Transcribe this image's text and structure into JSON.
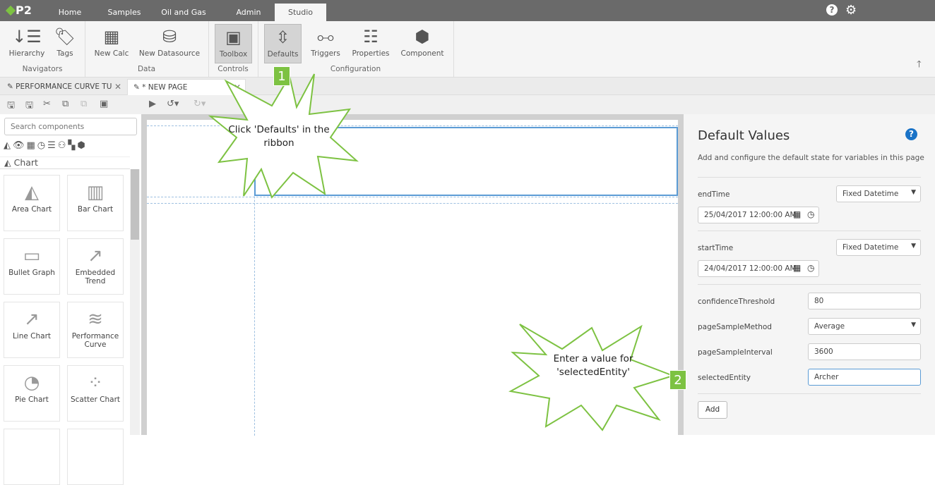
{
  "nav": {
    "logo": "P2",
    "tabs": [
      "Home",
      "Samples",
      "Oil and Gas",
      "Admin",
      "Studio"
    ],
    "active": "Studio",
    "help_icon": "?",
    "settings_icon": "gear"
  },
  "ribbon": {
    "buttons": [
      "Hierarchy",
      "Tags",
      "New Calc",
      "New Datasource",
      "Toolbox",
      "Defaults",
      "Triggers",
      "Properties",
      "Component"
    ],
    "groups": [
      "Navigators",
      "Data",
      "Controls",
      "Configuration"
    ]
  },
  "doc_tabs": [
    {
      "label": "PERFORMANCE CURVE TU"
    },
    {
      "label": "* NEW PAGE"
    }
  ],
  "left": {
    "search_placeholder": "Search components",
    "category": "Chart",
    "components": [
      "Area Chart",
      "Bar Chart",
      "Bullet Graph",
      "Embedded Trend",
      "Line Chart",
      "Performance Curve",
      "Pie Chart",
      "Scatter Chart"
    ]
  },
  "right": {
    "title": "Default Values",
    "description": "Add and configure the default state for variables in this page",
    "endTime": {
      "label": "endTime",
      "mode": "Fixed Datetime",
      "value": "25/04/2017 12:00:00 AM"
    },
    "startTime": {
      "label": "startTime",
      "mode": "Fixed Datetime",
      "value": "24/04/2017 12:00:00 AM"
    },
    "confidenceThreshold": {
      "label": "confidenceThreshold",
      "value": "80"
    },
    "pageSampleMethod": {
      "label": "pageSampleMethod",
      "value": "Average"
    },
    "pageSampleInterval": {
      "label": "pageSampleInterval",
      "value": "3600"
    },
    "selectedEntity": {
      "label": "selectedEntity",
      "value": "Archer"
    },
    "add": "Add"
  },
  "callouts": [
    {
      "num": "1",
      "text": "Click 'Defaults' in the ribbon"
    },
    {
      "num": "2",
      "text": "Enter a value for 'selectedEntity'"
    }
  ],
  "colors": {
    "accent": "#7dc242",
    "topbar": "#6a6a6a",
    "link": "#1a73c7"
  }
}
